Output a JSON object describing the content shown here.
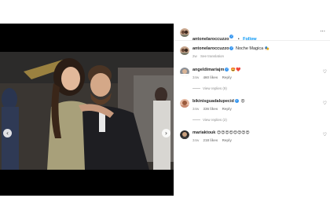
{
  "post": {
    "author": "antonelaroccuzzo",
    "follow_label": "Follow",
    "caption_text": "Noche Magica",
    "see_translation": "See translation"
  },
  "comments": [
    {
      "username": "angeldimariajm",
      "text": "",
      "emoji": "🤩❤️",
      "time": "34w",
      "likes": "460 likes",
      "reply_label": "Reply",
      "view_replies": "View replies (9)"
    },
    {
      "username": "bikinisguadalupecid",
      "text": "",
      "emoji": "😍",
      "time": "34w",
      "likes": "336 likes",
      "reply_label": "Reply",
      "view_replies": "View replies (2)"
    },
    {
      "username": "mariaktouk",
      "text": "",
      "emoji": "😍😍😍😍😍😍😍😍",
      "time": "34w",
      "likes": "218 likes",
      "reply_label": "Reply",
      "view_replies": ""
    }
  ],
  "colors": {
    "accent": "#0095f6",
    "verified": "#3897f0",
    "muted": "#8e8e8e"
  }
}
